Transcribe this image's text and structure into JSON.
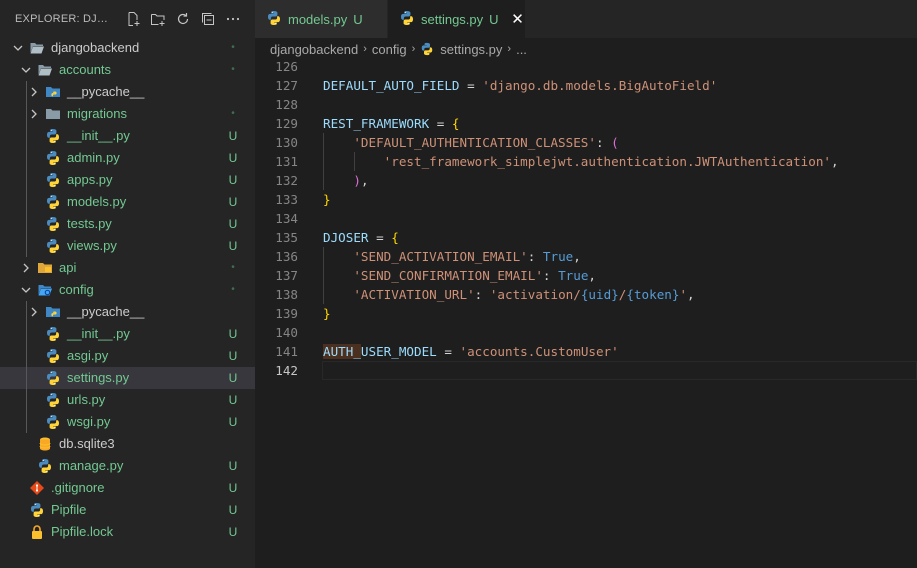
{
  "explorer": {
    "title": "EXPLORER: DJANGOBACKEND",
    "actions": [
      "new-file-icon",
      "new-folder-icon",
      "refresh-icon",
      "collapse-all-icon",
      "more-actions-icon"
    ]
  },
  "tree": [
    {
      "label": "djangobackend",
      "kind": "folder-open",
      "indent": 0,
      "status": "•",
      "status_kind": "dot",
      "color": "plain"
    },
    {
      "label": "accounts",
      "kind": "folder-open",
      "indent": 1,
      "status": "•",
      "status_kind": "dot",
      "color": "untracked"
    },
    {
      "label": "__pycache__",
      "kind": "folder-closed-py",
      "indent": 2,
      "status": "",
      "status_kind": "",
      "color": "plain"
    },
    {
      "label": "migrations",
      "kind": "folder-closed",
      "indent": 2,
      "status": "•",
      "status_kind": "dot",
      "color": "untracked"
    },
    {
      "label": "__init__.py",
      "kind": "python",
      "indent": 2,
      "status": "U",
      "status_kind": "untracked",
      "color": "untracked"
    },
    {
      "label": "admin.py",
      "kind": "python",
      "indent": 2,
      "status": "U",
      "status_kind": "untracked",
      "color": "untracked"
    },
    {
      "label": "apps.py",
      "kind": "python",
      "indent": 2,
      "status": "U",
      "status_kind": "untracked",
      "color": "untracked"
    },
    {
      "label": "models.py",
      "kind": "python",
      "indent": 2,
      "status": "U",
      "status_kind": "untracked",
      "color": "untracked"
    },
    {
      "label": "tests.py",
      "kind": "python",
      "indent": 2,
      "status": "U",
      "status_kind": "untracked",
      "color": "untracked"
    },
    {
      "label": "views.py",
      "kind": "python",
      "indent": 2,
      "status": "U",
      "status_kind": "untracked",
      "color": "untracked"
    },
    {
      "label": "api",
      "kind": "folder-closed-api",
      "indent": 1,
      "status": "•",
      "status_kind": "dot",
      "color": "untracked"
    },
    {
      "label": "config",
      "kind": "folder-open-config",
      "indent": 1,
      "status": "•",
      "status_kind": "dot",
      "color": "untracked"
    },
    {
      "label": "__pycache__",
      "kind": "folder-closed-py",
      "indent": 2,
      "status": "",
      "status_kind": "",
      "color": "plain"
    },
    {
      "label": "__init__.py",
      "kind": "python",
      "indent": 2,
      "status": "U",
      "status_kind": "untracked",
      "color": "untracked"
    },
    {
      "label": "asgi.py",
      "kind": "python",
      "indent": 2,
      "status": "U",
      "status_kind": "untracked",
      "color": "untracked"
    },
    {
      "label": "settings.py",
      "kind": "python",
      "indent": 2,
      "status": "U",
      "status_kind": "untracked",
      "color": "untracked",
      "selected": true
    },
    {
      "label": "urls.py",
      "kind": "python",
      "indent": 2,
      "status": "U",
      "status_kind": "untracked",
      "color": "untracked"
    },
    {
      "label": "wsgi.py",
      "kind": "python",
      "indent": 2,
      "status": "U",
      "status_kind": "untracked",
      "color": "untracked"
    },
    {
      "label": "db.sqlite3",
      "kind": "database",
      "indent": 1,
      "status": "",
      "status_kind": "",
      "color": "plain"
    },
    {
      "label": "manage.py",
      "kind": "python",
      "indent": 1,
      "status": "U",
      "status_kind": "untracked",
      "color": "untracked"
    },
    {
      "label": ".gitignore",
      "kind": "git",
      "indent": 0,
      "status": "U",
      "status_kind": "untracked",
      "color": "untracked"
    },
    {
      "label": "Pipfile",
      "kind": "python",
      "indent": 0,
      "status": "U",
      "status_kind": "untracked",
      "color": "untracked"
    },
    {
      "label": "Pipfile.lock",
      "kind": "lock",
      "indent": 0,
      "status": "U",
      "status_kind": "untracked",
      "color": "untracked"
    }
  ],
  "tabs": [
    {
      "label": "models.py",
      "status": "U",
      "active": false,
      "icon": "python-icon"
    },
    {
      "label": "settings.py",
      "status": "U",
      "active": true,
      "icon": "python-icon",
      "close": "✕"
    }
  ],
  "breadcrumbs": {
    "items": [
      "djangobackend",
      "config",
      "settings.py",
      "..."
    ],
    "separator": "›"
  },
  "code": {
    "current_line": 142,
    "lines": [
      {
        "n": "126",
        "tokens": []
      },
      {
        "n": "127",
        "tokens": [
          [
            "var",
            "DEFAULT_AUTO_FIELD"
          ],
          [
            "op",
            " = "
          ],
          [
            "str",
            "'django.db.models.BigAutoField'"
          ]
        ]
      },
      {
        "n": "128",
        "tokens": []
      },
      {
        "n": "129",
        "tokens": [
          [
            "var",
            "REST_FRAMEWORK"
          ],
          [
            "op",
            " = "
          ],
          [
            "br1",
            "{"
          ]
        ]
      },
      {
        "n": "130",
        "tokens": [
          [
            "op",
            "    "
          ],
          [
            "str",
            "'DEFAULT_AUTHENTICATION_CLASSES'"
          ],
          [
            "op",
            ": "
          ],
          [
            "br2",
            "("
          ]
        ]
      },
      {
        "n": "131",
        "tokens": [
          [
            "op",
            "        "
          ],
          [
            "str",
            "'rest_framework_simplejwt.authentication.JWTAuthentication'"
          ],
          [
            "op",
            ","
          ]
        ]
      },
      {
        "n": "132",
        "tokens": [
          [
            "op",
            "    "
          ],
          [
            "br2",
            ")"
          ],
          [
            "op",
            ","
          ]
        ]
      },
      {
        "n": "133",
        "tokens": [
          [
            "br1",
            "}"
          ]
        ]
      },
      {
        "n": "134",
        "tokens": []
      },
      {
        "n": "135",
        "tokens": [
          [
            "var",
            "DJOSER"
          ],
          [
            "op",
            " = "
          ],
          [
            "br1",
            "{"
          ]
        ]
      },
      {
        "n": "136",
        "tokens": [
          [
            "op",
            "    "
          ],
          [
            "str",
            "'SEND_ACTIVATION_EMAIL'"
          ],
          [
            "op",
            ": "
          ],
          [
            "kw",
            "True"
          ],
          [
            "op",
            ","
          ]
        ]
      },
      {
        "n": "137",
        "tokens": [
          [
            "op",
            "    "
          ],
          [
            "str",
            "'SEND_CONFIRMATION_EMAIL'"
          ],
          [
            "op",
            ": "
          ],
          [
            "kw",
            "True"
          ],
          [
            "op",
            ","
          ]
        ]
      },
      {
        "n": "138",
        "tokens": [
          [
            "op",
            "    "
          ],
          [
            "str",
            "'ACTIVATION_URL'"
          ],
          [
            "op",
            ": "
          ],
          [
            "str",
            "'activation/"
          ],
          [
            "esc",
            "{uid}"
          ],
          [
            "str",
            "/"
          ],
          [
            "esc",
            "{token}"
          ],
          [
            "str",
            "'"
          ],
          [
            "op",
            ","
          ]
        ]
      },
      {
        "n": "139",
        "tokens": [
          [
            "br1",
            "}"
          ]
        ]
      },
      {
        "n": "140",
        "tokens": []
      },
      {
        "n": "141",
        "tokens": [
          [
            "var-hl",
            "AUTH_"
          ],
          [
            "var",
            "USER_MODEL"
          ],
          [
            "op",
            " = "
          ],
          [
            "str",
            "'accounts.CustomUser'"
          ]
        ]
      },
      {
        "n": "142",
        "tokens": []
      }
    ]
  },
  "colors": {
    "untracked": "#73c991",
    "sidebar_bg": "#252526",
    "editor_bg": "#1e1e1e",
    "selection": "#37373d"
  }
}
